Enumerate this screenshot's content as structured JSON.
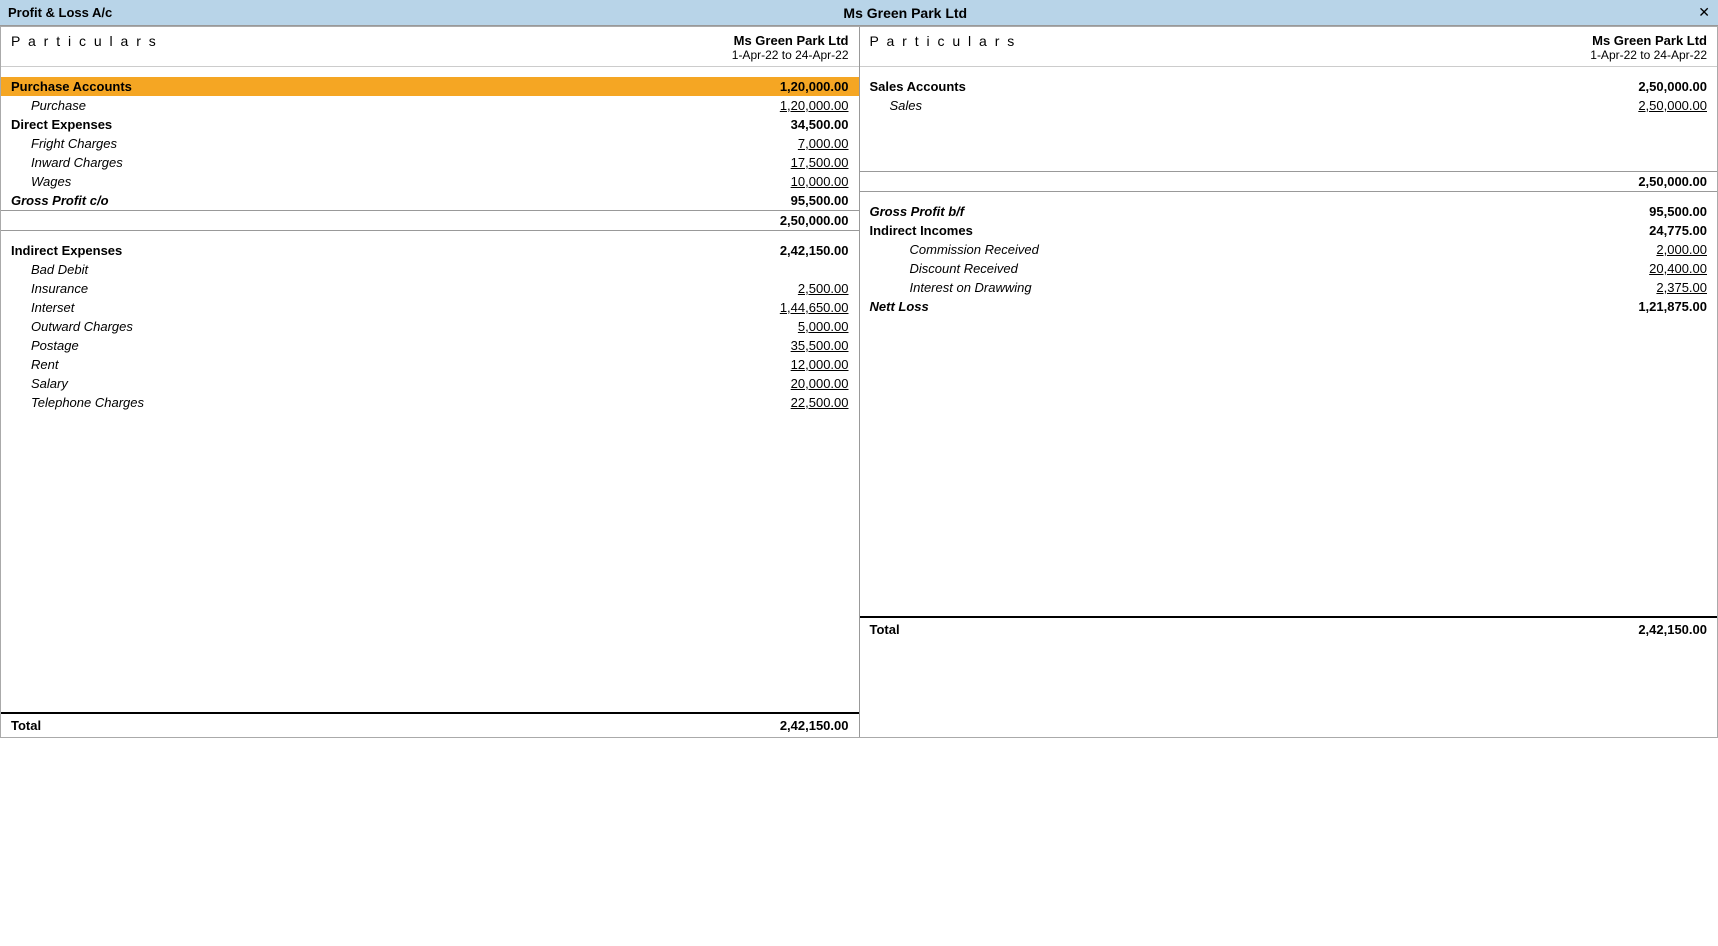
{
  "titleBar": {
    "left": "Profit & Loss A/c",
    "center": "Ms Green Park Ltd",
    "close": "✕"
  },
  "leftPanel": {
    "particulars": "P a r t i c u l a r s",
    "company": "Ms Green Park Ltd",
    "dateRange": "1-Apr-22 to 24-Apr-22",
    "purchaseAccounts": {
      "label": "Purchase Accounts",
      "total": "1,20,000.00",
      "purchase": "Purchase",
      "purchaseAmount": "1,20,000.00"
    },
    "directExpenses": {
      "label": "Direct Expenses",
      "total": "34,500.00",
      "items": [
        {
          "name": "Fright Charges",
          "amount": "7,000.00"
        },
        {
          "name": "Inward Charges",
          "amount": "17,500.00"
        },
        {
          "name": "Wages",
          "amount": "10,000.00"
        }
      ]
    },
    "grossProfit": {
      "label": "Gross Profit c/o",
      "amount": "95,500.00"
    },
    "subtotal": "2,50,000.00",
    "indirectExpenses": {
      "label": "Indirect Expenses",
      "total": "2,42,150.00",
      "items": [
        {
          "name": "Bad Debit",
          "amount": ""
        },
        {
          "name": "Insurance",
          "amount": "2,500.00"
        },
        {
          "name": "Interset",
          "amount": "1,44,650.00"
        },
        {
          "name": "Outward Charges",
          "amount": "5,000.00"
        },
        {
          "name": "Postage",
          "amount": "35,500.00"
        },
        {
          "name": "Rent",
          "amount": "12,000.00"
        },
        {
          "name": "Salary",
          "amount": "20,000.00"
        },
        {
          "name": "Telephone Charges",
          "amount": "22,500.00"
        }
      ]
    },
    "total": {
      "label": "Total",
      "amount": "2,42,150.00"
    }
  },
  "rightPanel": {
    "particulars": "P a r t i c u l a r s",
    "company": "Ms Green Park Ltd",
    "dateRange": "1-Apr-22 to 24-Apr-22",
    "salesAccounts": {
      "label": "Sales Accounts",
      "total": "2,50,000.00",
      "sales": "Sales",
      "salesAmount": "2,50,000.00"
    },
    "subtotal": "2,50,000.00",
    "grossProfitBf": {
      "label": "Gross Profit b/f",
      "amount": "95,500.00"
    },
    "indirectIncomes": {
      "label": "Indirect Incomes",
      "total": "24,775.00",
      "items": [
        {
          "name": "Commission Received",
          "amount": "2,000.00"
        },
        {
          "name": "Discount Received",
          "amount": "20,400.00"
        },
        {
          "name": "Interest on Drawwing",
          "amount": "2,375.00"
        }
      ]
    },
    "nettLoss": {
      "label": "Nett Loss",
      "amount": "1,21,875.00"
    },
    "total": {
      "label": "Total",
      "amount": "2,42,150.00"
    }
  }
}
